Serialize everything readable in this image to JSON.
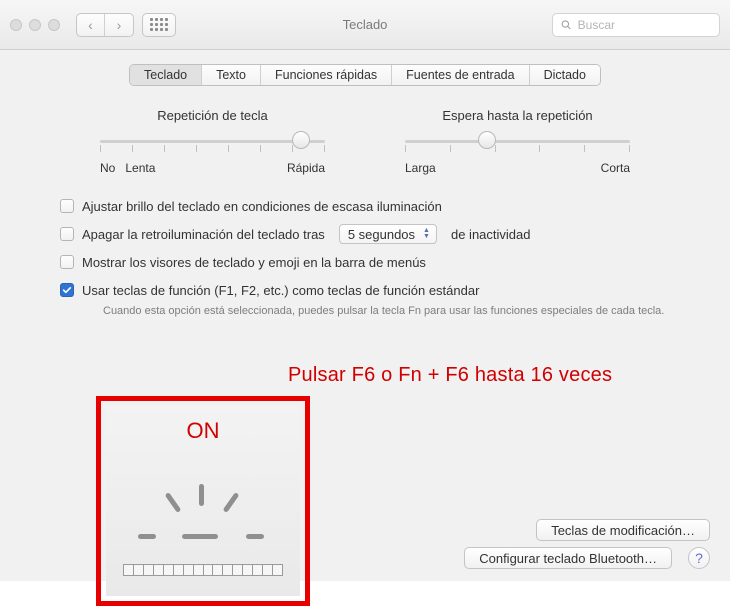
{
  "window": {
    "title": "Teclado"
  },
  "toolbar": {
    "search_placeholder": "Buscar"
  },
  "tabs": {
    "keyboard": "Teclado",
    "text": "Texto",
    "shortcuts": "Funciones rápidas",
    "sources": "Fuentes de entrada",
    "dictation": "Dictado",
    "active": "keyboard"
  },
  "sliders": {
    "repeat": {
      "title": "Repetición de tecla",
      "left1": "No",
      "left2": "Lenta",
      "right": "Rápida",
      "ticks": 8,
      "position_pct": 89
    },
    "delay": {
      "title": "Espera hasta la repetición",
      "left": "Larga",
      "right": "Corta",
      "ticks": 6,
      "position_pct": 36
    }
  },
  "options": {
    "adjust_brightness": {
      "checked": false,
      "label": "Ajustar brillo del teclado en condiciones de escasa iluminación"
    },
    "turn_off_backlight": {
      "checked": false,
      "label_before": "Apagar la retroiluminación del teclado tras",
      "popup_value": "5 segundos",
      "label_after": "de inactividad"
    },
    "show_viewers": {
      "checked": false,
      "label": "Mostrar los visores de teclado y emoji en la barra de menús"
    },
    "use_fn": {
      "checked": true,
      "label": "Usar teclas de función (F1, F2, etc.) como teclas de función estándar",
      "hint": "Cuando esta opción está seleccionada, puedes pulsar la tecla Fn para usar las funciones especiales de cada tecla."
    }
  },
  "buttons": {
    "modifier": "Teclas de modificación…",
    "bluetooth": "Configurar teclado Bluetooth…",
    "help": "?"
  },
  "annotation": {
    "instruction": "Pulsar F6 o Fn + F6 hasta 16 veces",
    "overlay_title": "ON",
    "ruler_segments": 16
  }
}
